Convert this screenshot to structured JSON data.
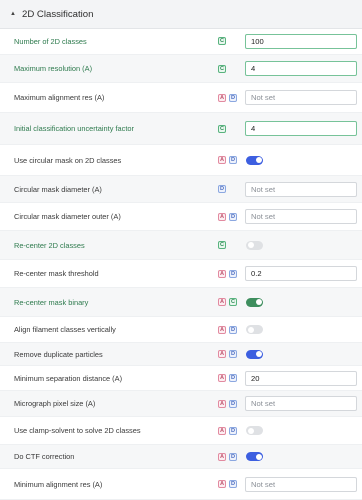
{
  "section": {
    "title": "2D Classification"
  },
  "rows": [
    {
      "label": "Number of 2D classes",
      "value": "100"
    },
    {
      "label": "Maximum resolution (A)",
      "value": "4"
    },
    {
      "label": "Maximum alignment res (A)",
      "placeholder": "Not set"
    },
    {
      "label": "Initial classification uncertainty factor",
      "value": "4"
    },
    {
      "label": "Use circular mask on 2D classes",
      "state": "on"
    },
    {
      "label": "Circular mask diameter (A)",
      "placeholder": "Not set"
    },
    {
      "label": "Circular mask diameter outer (A)",
      "placeholder": "Not set"
    },
    {
      "label": "Re-center 2D classes",
      "state": "off"
    },
    {
      "label": "Re-center mask threshold",
      "value": "0.2"
    },
    {
      "label": "Re-center mask binary",
      "state": "on"
    },
    {
      "label": "Align filament classes vertically",
      "state": "off"
    },
    {
      "label": "Remove duplicate particles",
      "state": "on"
    },
    {
      "label": "Minimum separation distance (A)",
      "value": "20"
    },
    {
      "label": "Micrograph pixel size (A)",
      "placeholder": "Not set"
    },
    {
      "label": "Use clamp-solvent to solve 2D classes",
      "state": "off"
    },
    {
      "label": "Do CTF correction",
      "state": "on"
    },
    {
      "label": "Minimum alignment res (A)",
      "placeholder": "Not set"
    }
  ],
  "badges": {
    "C": "C",
    "A": "A",
    "D": "D"
  },
  "colors": {
    "accent_green": "#2d7a4d",
    "toggle_blue": "#3d5fe0",
    "toggle_green": "#3e8e5e"
  },
  "icons": {
    "collapse": "chevron-up-icon"
  }
}
